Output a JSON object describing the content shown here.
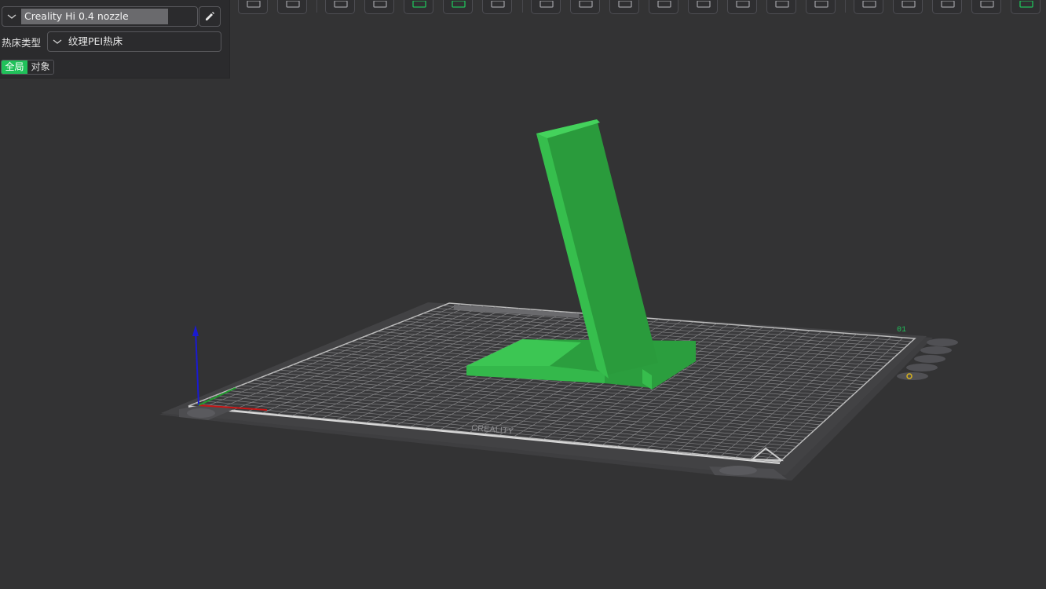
{
  "panel": {
    "printer_preset": "Creality Hi 0.4 nozzle",
    "bed_type_label": "热床类型",
    "bed_type_value": "纹理PEI热床",
    "scope_global": "全局",
    "scope_object": "对象"
  },
  "toolbar": {
    "tools": [
      {
        "name": "add-cube-icon",
        "active": false
      },
      {
        "name": "grid-plate-icon",
        "active": false
      },
      {
        "name": "orient-icon",
        "active": false
      },
      {
        "name": "arrange-icon",
        "active": false
      },
      {
        "name": "paint-bed-icon",
        "active": true
      },
      {
        "name": "split-objects-icon",
        "active": true
      },
      {
        "name": "cut-plane-icon",
        "active": false
      },
      {
        "name": "layout-icon",
        "active": false
      },
      {
        "name": "settings-gear-icon",
        "active": false
      },
      {
        "name": "support-icon",
        "active": false
      },
      {
        "name": "layers-icon",
        "active": false
      },
      {
        "name": "hollow-icon",
        "active": false
      },
      {
        "name": "measure-icon",
        "active": false
      },
      {
        "name": "boolean-icon",
        "active": false
      },
      {
        "name": "text-tool-icon",
        "active": false
      },
      {
        "name": "seam-paint-icon",
        "active": false
      },
      {
        "name": "fuzzy-skin-icon",
        "active": false
      },
      {
        "name": "slice-view-icon",
        "active": false
      },
      {
        "name": "color-paint-icon",
        "active": false
      },
      {
        "name": "assembly-text-icon",
        "active": true
      }
    ]
  },
  "scene": {
    "bed_brand_text": "CREALITY",
    "plate_number": "01",
    "model_color": "#2fbf4a",
    "accent_color": "#20c15a"
  }
}
